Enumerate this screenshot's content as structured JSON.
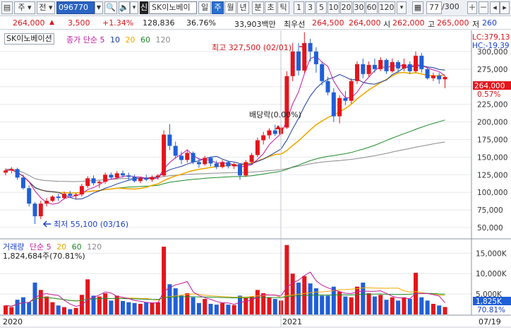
{
  "toolbar": {
    "kind": "주",
    "prefix": "전",
    "code": "096770",
    "market_badge": "신",
    "stock_name": "SK이노베이",
    "periods": [
      "일",
      "주",
      "월",
      "년",
      "분",
      "초",
      "틱"
    ],
    "active_period": "주",
    "intervals": [
      "1",
      "3",
      "5",
      "10",
      "20",
      "30",
      "60",
      "120"
    ],
    "count": "77",
    "count_total": "/300"
  },
  "quote": {
    "price": "264,000",
    "change": "3,500",
    "change_pct": "+1.34%",
    "volume": "128,836",
    "volume_ratio": "36.76%",
    "trade_amount": "33,903백만",
    "priority_sell_label": "최우선",
    "priority_sell": "264,500",
    "priority_buy": "264,000",
    "open_label": "시",
    "open": "262,000",
    "high_label": "고",
    "high": "265,000",
    "low_label": "저",
    "low": "260"
  },
  "colors": {
    "up": "#e5141b",
    "down": "#1f5fd8",
    "ma5": "#c01a9e",
    "ma10": "#1b3a9a",
    "ma20": "#f0a800",
    "ma60": "#1e8a2a",
    "ma120": "#8a8a8a",
    "volume_ma": "#c01a9e"
  },
  "price_panel": {
    "legend_name": "SK이노베이션",
    "legend_ma_label": "종가 단순",
    "ma_periods": [
      "5",
      "10",
      "20",
      "60",
      "120"
    ],
    "max_label": "최고 327,500 (02/01)",
    "min_label": "최저 55,100 (03/16)",
    "dividend_label": "배당락(0.00%)",
    "lc": "LC:379,13",
    "hc": "HC:-19.39",
    "current_price_tag": "264,000",
    "current_pct_tag": "0.57%"
  },
  "volume_panel": {
    "legend_name": "거래량",
    "legend_ma_label": "단순",
    "ma_periods": [
      "5",
      "20",
      "60",
      "120"
    ],
    "last_value": "1,824,684주(70.81%)",
    "current_tag": "1,825K",
    "current_pct_tag": "70.81%"
  },
  "x_axis": {
    "labels": [
      "2020",
      "2021",
      "07/19"
    ]
  },
  "chart_data": [
    {
      "type": "candlestick",
      "title": "SK이노베이션",
      "y_ticks": [
        50000,
        75000,
        100000,
        125000,
        150000,
        175000,
        200000,
        225000,
        250000,
        275000,
        300000
      ],
      "ylim": [
        35000,
        330000
      ],
      "x_labels": [
        "2020",
        "2021"
      ],
      "ohlc": [
        [
          128000,
          134000,
          124000,
          131000
        ],
        [
          131000,
          136000,
          127000,
          133000
        ],
        [
          133000,
          135000,
          118000,
          121000
        ],
        [
          121000,
          125000,
          104000,
          106000
        ],
        [
          106000,
          110000,
          80000,
          84000
        ],
        [
          84000,
          86000,
          55100,
          66000
        ],
        [
          66000,
          88000,
          62000,
          84000
        ],
        [
          84000,
          92000,
          80000,
          88000
        ],
        [
          88000,
          96000,
          86000,
          94000
        ],
        [
          94000,
          98000,
          88000,
          92000
        ],
        [
          92000,
          101000,
          90000,
          98000
        ],
        [
          98000,
          102000,
          92000,
          95000
        ],
        [
          95000,
          99000,
          90000,
          97000
        ],
        [
          97000,
          112000,
          94000,
          109000
        ],
        [
          109000,
          123000,
          106000,
          120000
        ],
        [
          120000,
          124000,
          110000,
          113000
        ],
        [
          113000,
          117000,
          106000,
          115000
        ],
        [
          115000,
          128000,
          112000,
          125000
        ],
        [
          125000,
          128000,
          118000,
          121000
        ],
        [
          121000,
          130000,
          119000,
          127000
        ],
        [
          127000,
          131000,
          121000,
          124000
        ],
        [
          124000,
          128000,
          117000,
          122000
        ],
        [
          122000,
          125000,
          114000,
          116000
        ],
        [
          116000,
          122000,
          113000,
          120000
        ],
        [
          120000,
          125000,
          116000,
          118000
        ],
        [
          118000,
          124000,
          115000,
          122000
        ],
        [
          122000,
          126000,
          118000,
          124000
        ],
        [
          124000,
          188000,
          122000,
          182000
        ],
        [
          182000,
          197000,
          160000,
          166000
        ],
        [
          166000,
          172000,
          148000,
          152000
        ],
        [
          152000,
          158000,
          140000,
          146000
        ],
        [
          146000,
          160000,
          142000,
          156000
        ],
        [
          156000,
          158000,
          140000,
          143000
        ],
        [
          143000,
          149000,
          135000,
          140000
        ],
        [
          140000,
          152000,
          138000,
          149000
        ],
        [
          149000,
          151000,
          137000,
          141000
        ],
        [
          141000,
          145000,
          133000,
          136000
        ],
        [
          136000,
          146000,
          134000,
          143000
        ],
        [
          143000,
          145000,
          134000,
          137000
        ],
        [
          137000,
          142000,
          133000,
          140000
        ],
        [
          140000,
          141000,
          118000,
          124000
        ],
        [
          124000,
          146000,
          122000,
          143000
        ],
        [
          143000,
          156000,
          139000,
          153000
        ],
        [
          153000,
          178000,
          150000,
          174000
        ],
        [
          174000,
          186000,
          168000,
          181000
        ],
        [
          181000,
          191000,
          176000,
          188000
        ],
        [
          188000,
          196000,
          180000,
          183000
        ],
        [
          183000,
          196000,
          180000,
          192000
        ],
        [
          192000,
          272000,
          190000,
          265000
        ],
        [
          265000,
          312000,
          258000,
          300000
        ],
        [
          300000,
          312000,
          266000,
          273000
        ],
        [
          273000,
          327500,
          270000,
          312000
        ],
        [
          312000,
          318000,
          286000,
          300000
        ],
        [
          300000,
          306000,
          270000,
          282000
        ],
        [
          282000,
          286000,
          252000,
          258000
        ],
        [
          258000,
          264000,
          238000,
          242000
        ],
        [
          242000,
          248000,
          200000,
          208000
        ],
        [
          208000,
          238000,
          198000,
          234000
        ],
        [
          234000,
          244000,
          224000,
          230000
        ],
        [
          230000,
          262000,
          226000,
          258000
        ],
        [
          258000,
          286000,
          254000,
          282000
        ],
        [
          282000,
          290000,
          262000,
          268000
        ],
        [
          268000,
          286000,
          264000,
          281000
        ],
        [
          281000,
          290000,
          270000,
          275000
        ],
        [
          275000,
          292000,
          272000,
          288000
        ],
        [
          288000,
          290000,
          268000,
          272000
        ],
        [
          272000,
          290000,
          270000,
          285000
        ],
        [
          285000,
          288000,
          270000,
          276000
        ],
        [
          276000,
          290000,
          272000,
          282000
        ],
        [
          282000,
          286000,
          268000,
          272000
        ],
        [
          272000,
          300000,
          270000,
          294000
        ],
        [
          294000,
          298000,
          270000,
          275000
        ],
        [
          275000,
          278000,
          260000,
          262000
        ],
        [
          262000,
          270000,
          258000,
          266000
        ],
        [
          266000,
          270000,
          254000,
          260500
        ],
        [
          260500,
          265000,
          248000,
          264000
        ]
      ]
    },
    {
      "type": "bar",
      "title": "거래량",
      "y_ticks": [
        5000,
        10000,
        15000
      ],
      "y_tick_labels": [
        "5,000K",
        "10,000K",
        "15,000K"
      ],
      "ylim": [
        0,
        18000
      ],
      "values": [
        2200,
        1800,
        3600,
        4200,
        3000,
        7800,
        6000,
        4400,
        3000,
        2200,
        1800,
        1300,
        1600,
        4800,
        8600,
        4600,
        4400,
        5200,
        3400,
        4600,
        3300,
        3000,
        2800,
        2600,
        3000,
        2800,
        3000,
        16600,
        7400,
        6400,
        4600,
        5200,
        4200,
        2800,
        3800,
        2600,
        2400,
        2800,
        2400,
        2300,
        4600,
        4000,
        4400,
        6000,
        5200,
        4200,
        3800,
        3400,
        17000,
        10000,
        7800,
        9400,
        7600,
        6400,
        4600,
        4600,
        6800,
        5600,
        4400,
        4200,
        6800,
        7800,
        5200,
        4400,
        4800,
        3600,
        4200,
        3400,
        4200,
        3800,
        10200,
        4200,
        3400,
        2600,
        2200,
        1825
      ]
    }
  ]
}
